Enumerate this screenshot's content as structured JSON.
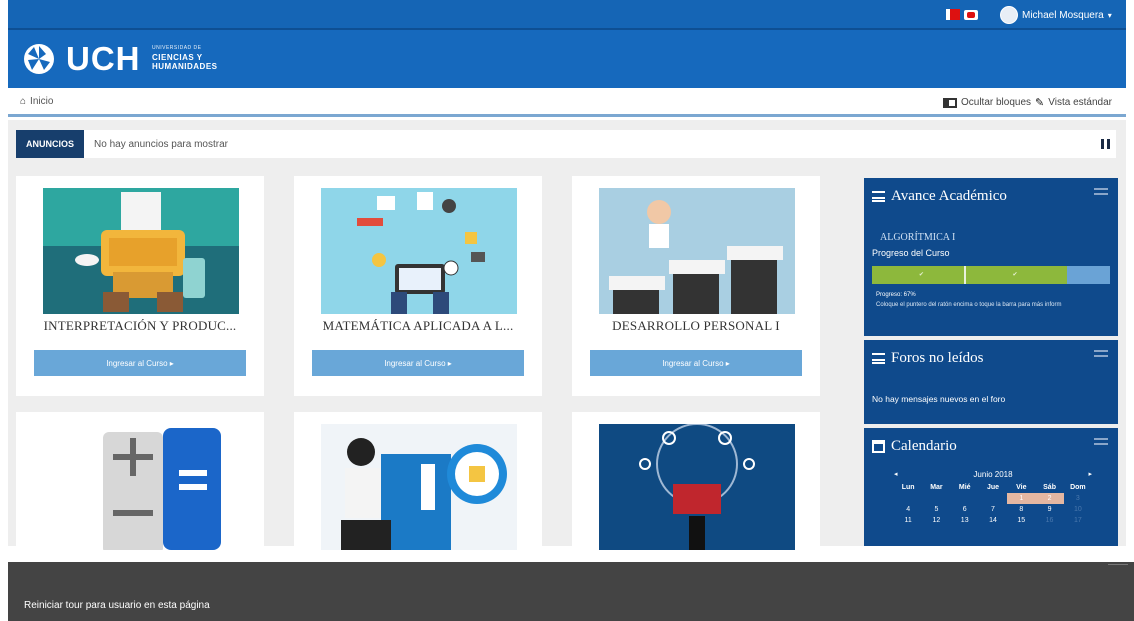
{
  "topbar": {
    "user_name": "Michael Mosquera",
    "caret": "▾"
  },
  "logo": {
    "main": "UCH",
    "sub_small": "UNIVERSIDAD DE",
    "sub_line1": "CIENCIAS Y",
    "sub_line2": "HUMANIDADES"
  },
  "breadcrumb": {
    "home_icon": "⌂",
    "home": "Inicio",
    "hide_blocks": "Ocultar bloques",
    "standard_view": "Vista estándar"
  },
  "announcements": {
    "badge": "ANUNCIOS",
    "message": "No hay anuncios para mostrar"
  },
  "courses": [
    {
      "title": "INTERPRETACIÓN Y PRODUC...",
      "button": "Ingresar al Curso ▸"
    },
    {
      "title": "MATEMÁTICA APLICADA A L...",
      "button": "Ingresar al Curso ▸"
    },
    {
      "title": "DESARROLLO PERSONAL I",
      "button": "Ingresar al Curso ▸"
    },
    {
      "title": "",
      "button": ""
    },
    {
      "title": "",
      "button": ""
    },
    {
      "title": "",
      "button": ""
    }
  ],
  "sidebar": {
    "avance": {
      "title": "Avance Académico",
      "course": "ALGORÍTMICA I",
      "progress_label": "Progreso del Curso",
      "progress_fraction": 0.82,
      "progress_text": "Progreso: 67%",
      "hint": "Coloque el puntero del ratón encima o toque la barra para más inform"
    },
    "foros": {
      "title": "Foros no leídos",
      "message": "No hay mensajes nuevos en el foro"
    },
    "calendario": {
      "title": "Calendario",
      "prev": "◂",
      "next": "▸",
      "month": "Junio 2018",
      "weekdays": [
        "Lun",
        "Mar",
        "Mié",
        "Jue",
        "Vie",
        "Sáb",
        "Dom"
      ],
      "row1": [
        "",
        "",
        "",
        "",
        "1",
        "2",
        "3"
      ],
      "row2": [
        "4",
        "5",
        "6",
        "7",
        "8",
        "9",
        "10"
      ],
      "row3": [
        "11",
        "12",
        "13",
        "14",
        "15",
        "16",
        "17"
      ]
    }
  },
  "tour": {
    "text": "Reiniciar tour para usuario en esta página"
  },
  "colors": {
    "brand_blue": "#1669bd",
    "sidebar_blue": "#0f4a8c",
    "button_blue": "#69a7d8",
    "progress_green": "#8db83c"
  }
}
